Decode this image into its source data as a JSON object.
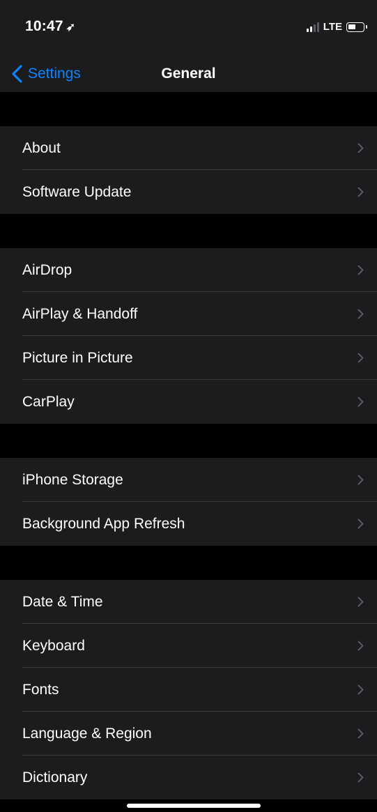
{
  "status_bar": {
    "time": "10:47",
    "location_icon": "location-arrow-icon",
    "network": "LTE",
    "signal_bars_active": 2,
    "signal_bars_total": 4,
    "battery_level": 0.55
  },
  "nav": {
    "back_label": "Settings",
    "title": "General"
  },
  "groups": [
    {
      "items": [
        "About",
        "Software Update"
      ]
    },
    {
      "items": [
        "AirDrop",
        "AirPlay & Handoff",
        "Picture in Picture",
        "CarPlay"
      ]
    },
    {
      "items": [
        "iPhone Storage",
        "Background App Refresh"
      ]
    },
    {
      "items": [
        "Date & Time",
        "Keyboard",
        "Fonts",
        "Language & Region",
        "Dictionary"
      ]
    }
  ],
  "colors": {
    "accent": "#0a84ff",
    "background": "#000000",
    "cell": "#1c1c1e",
    "separator": "#38383a",
    "chevron": "#5a5a5f"
  }
}
